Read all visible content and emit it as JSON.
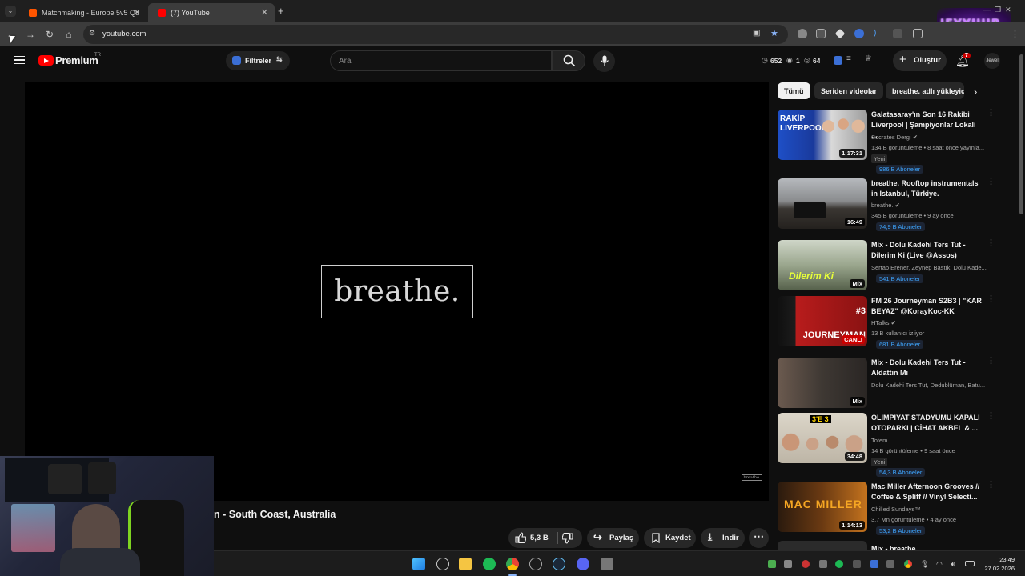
{
  "browser": {
    "tabs": [
      {
        "label": "Matchmaking - Europe 5v5 Qu",
        "active": false
      },
      {
        "label": "(7) YouTube",
        "active": true
      }
    ],
    "url": "youtube.com",
    "overlay_logo": "JEYYUUB"
  },
  "header": {
    "brand": "Premium",
    "country": "TR",
    "filter_label": "Filtreler",
    "search_placeholder": "Ara",
    "stats": {
      "time": "652",
      "eye": "1",
      "views": "64"
    },
    "create_label": "Oluştur",
    "notifications": "7",
    "avatar_text": "Jewel"
  },
  "player": {
    "center_brand": "breathe.",
    "watermark": "breathe.",
    "title": "n - South Coast, Australia",
    "actions": {
      "likes": "5,3 B",
      "share": "Paylaş",
      "save": "Kaydet",
      "download": "İndir"
    }
  },
  "chips": [
    "Tümü",
    "Seriden videolar",
    "breathe. adlı yükleyic"
  ],
  "sidebar_videos": [
    {
      "title": "Galatasaray'ın Son 16 Rakibi Liverpool | Şampiyonlar Lokali ...",
      "channel": "Socrates Dergi",
      "verified": true,
      "meta": "134 B görüntüleme • 8 saat önce yayınla...",
      "badge": "Yeni",
      "subs": "986 B Aboneler",
      "duration": "1:17:31",
      "thumb_text": "RAKİP LIVERPOOL"
    },
    {
      "title": "breathe. Rooftop instrumentals in İstanbul, Türkiye.",
      "channel": "breathe.",
      "verified": true,
      "meta": "345 B görüntüleme • 9 ay önce",
      "badge": "",
      "subs": "74,9 B Aboneler",
      "duration": "16:49",
      "thumb_text": ""
    },
    {
      "title": "Mix - Dolu Kadehi Ters Tut - Dilerim Ki (Live @Assos)",
      "channel": "Sertab Erener, Zeynep Bastık, Dolu Kade...",
      "verified": false,
      "meta": "",
      "badge": "",
      "subs": "541 B Aboneler",
      "duration": "Mix",
      "thumb_text": "Dilerim Ki"
    },
    {
      "title": "FM 26 Journeyman S2B3 | \"KAR BEYAZ\" @KorayKoc-KK",
      "channel": "HTalks",
      "verified": true,
      "meta": "13 B kullanıcı izliyor",
      "badge": "",
      "subs": "681 B Aboneler",
      "duration": "CANLI",
      "thumb_text": "#3 JOURNEYMAN"
    },
    {
      "title": "Mix - Dolu Kadehi Ters Tut - Aldattın Mı",
      "channel": "Dolu Kadehi Ters Tut, Dedublüman, Batu...",
      "verified": false,
      "meta": "",
      "badge": "",
      "subs": "",
      "duration": "Mix",
      "thumb_text": ""
    },
    {
      "title": "OLİMPİYAT STADYUMU KAPALI OTOPARKI | CİHAT AKBEL & ...",
      "channel": "Totem",
      "verified": false,
      "meta": "14 B görüntüleme • 9 saat önce",
      "badge": "Yeni",
      "subs": "54,3 B Aboneler",
      "duration": "34:48",
      "thumb_text": "3'E 3"
    },
    {
      "title": "Mac Miller Afternoon Grooves // Coffee & Spliff // Vinyl Selecti...",
      "channel": "Chilled Sundays™",
      "verified": false,
      "meta": "3,7 Mn görüntüleme • 4 ay önce",
      "badge": "",
      "subs": "53,2 B Aboneler",
      "duration": "1:14:13",
      "thumb_text": "MAC MILLER"
    },
    {
      "title": "Mix - breathe.",
      "channel": "",
      "verified": false,
      "meta": "",
      "badge": "",
      "subs": "",
      "duration": "",
      "thumb_text": ""
    }
  ],
  "taskbar": {
    "time": "23:49",
    "date": "27.02.2026"
  },
  "colors": {
    "accent": "#ff0000",
    "subs_link": "#3ea6ff",
    "bg": "#0f0f0f"
  }
}
